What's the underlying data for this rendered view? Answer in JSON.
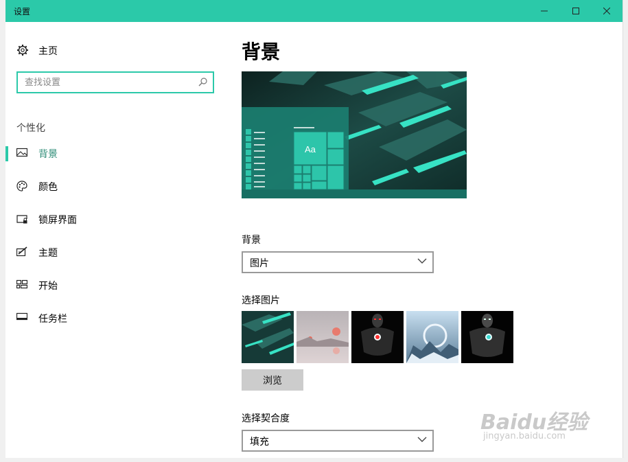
{
  "window": {
    "title": "设置"
  },
  "sidebar": {
    "home_label": "主页",
    "search_placeholder": "查找设置",
    "section_title": "个性化",
    "items": [
      {
        "label": "背景",
        "icon": "image-icon",
        "active": true
      },
      {
        "label": "颜色",
        "icon": "palette-icon",
        "active": false
      },
      {
        "label": "锁屏界面",
        "icon": "lock-screen-icon",
        "active": false
      },
      {
        "label": "主题",
        "icon": "theme-icon",
        "active": false
      },
      {
        "label": "开始",
        "icon": "start-icon",
        "active": false
      },
      {
        "label": "任务栏",
        "icon": "taskbar-icon",
        "active": false
      }
    ]
  },
  "main": {
    "title": "背景",
    "preview": {
      "tile_text": "Aa"
    },
    "background_label": "背景",
    "background_value": "图片",
    "choose_picture_label": "选择图片",
    "browse_label": "浏览",
    "fit_label": "选择契合度",
    "fit_value": "填充"
  },
  "watermark": {
    "brand": "Baidu经验",
    "url": "jingyan.baidu.com"
  },
  "colors": {
    "accent": "#2bc9a9",
    "accent_text": "#2a8a74"
  }
}
